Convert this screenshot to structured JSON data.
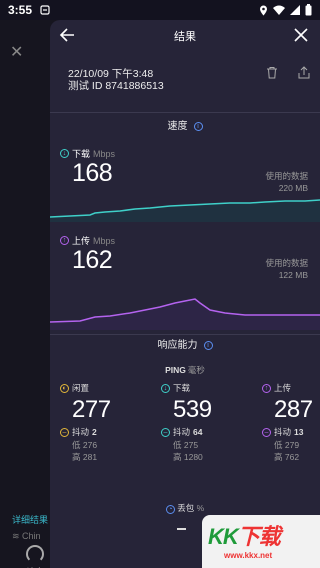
{
  "status": {
    "time": "3:55"
  },
  "background": {
    "detail_link": "详细结果",
    "wifi_text": "Chin",
    "nav_speed": "速度"
  },
  "header": {
    "title": "结果"
  },
  "meta": {
    "datetime": "22/10/09 下午3:48",
    "test_id": "测试 ID 8741886513"
  },
  "speed": {
    "section_title": "速度",
    "download": {
      "label": "下载",
      "unit": "Mbps",
      "value": "168",
      "used_label": "使用的数据",
      "used_value": "220 MB",
      "color": "#3fd0c9"
    },
    "upload": {
      "label": "上传",
      "unit": "Mbps",
      "value": "162",
      "used_label": "使用的数据",
      "used_value": "122 MB",
      "color": "#b463ef"
    }
  },
  "responsiveness": {
    "section_title": "响应能力",
    "ping_label": "PING",
    "ping_unit": "毫秒",
    "idle": {
      "label": "闲置",
      "value": "277",
      "jitter_label": "抖动",
      "jitter": "2",
      "low": "低 276",
      "high": "高 281",
      "color": "#e2b73a"
    },
    "download": {
      "label": "下载",
      "value": "539",
      "jitter_label": "抖动",
      "jitter": "64",
      "low": "低 275",
      "high": "高 1280",
      "color": "#3fd0c9"
    },
    "upload": {
      "label": "上传",
      "value": "287",
      "jitter_label": "抖动",
      "jitter": "13",
      "low": "低 279",
      "high": "高 762",
      "color": "#b463ef"
    }
  },
  "packet_loss": {
    "label": "丢包",
    "unit": "%"
  },
  "watermark": {
    "logo_a": "KK",
    "logo_b": "下载",
    "url": "www.kkx.net"
  }
}
